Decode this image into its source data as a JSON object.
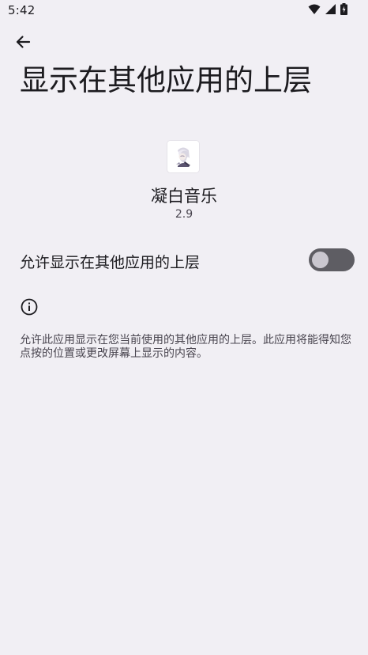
{
  "status_bar": {
    "time": "5:42",
    "icons": [
      "wifi-icon",
      "cellular-signal-icon",
      "battery-charging-icon"
    ]
  },
  "app_bar": {
    "back_icon": "arrow-back-icon",
    "title": "显示在其他应用的上层"
  },
  "app": {
    "name": "凝白音乐",
    "version": "2.9"
  },
  "setting": {
    "label": "允许显示在其他应用的上层",
    "enabled": false
  },
  "info": {
    "icon": "info-icon",
    "text": "允许此应用显示在您当前使用的其他应用的上层。此应用将能得知您点按的位置或更改屏幕上显示的内容。"
  },
  "colors": {
    "background": "#f1eff4",
    "toggle_track_off": "#5e5d63",
    "toggle_thumb_off": "#cac7cf",
    "text_primary": "#1c1b1f",
    "text_secondary": "#49454f"
  }
}
